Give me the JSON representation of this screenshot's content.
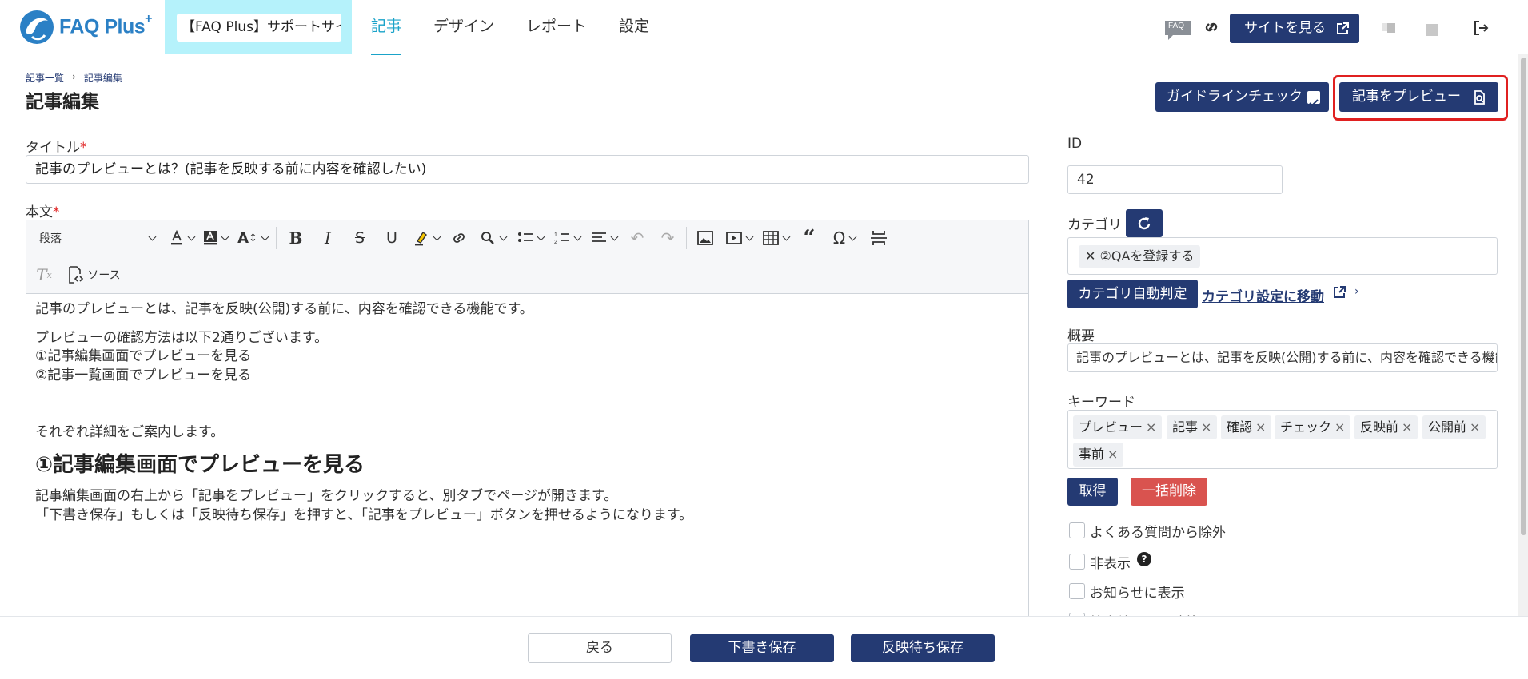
{
  "header": {
    "logo_text": "FAQ Plus",
    "logo_plus": "+",
    "site_selector": "【FAQ Plus】サポートサイト",
    "nav": [
      "記事",
      "デザイン",
      "レポート",
      "設定"
    ],
    "faq_badge": "FAQ",
    "view_site": "サイトを見る"
  },
  "breadcrumb": [
    "記事一覧",
    "記事編集"
  ],
  "page_title": "記事編集",
  "actions": {
    "guideline_check": "ガイドラインチェック",
    "preview": "記事をプレビュー"
  },
  "form": {
    "title_label": "タイトル",
    "required_mark": "*",
    "title_value": "記事のプレビューとは？(記事を反映する前に内容を確認したい)",
    "body_label": "本文"
  },
  "editor": {
    "paragraph_select": "段落",
    "source_label": "ソース",
    "lines": [
      "記事のプレビューとは、記事を反映(公開)する前に、内容を確認できる機能です。",
      "プレビューの確認方法は以下2通りございます。",
      "①記事編集画面でプレビューを見る",
      "②記事一覧画面でプレビューを見る",
      "それぞれ詳細をご案内します。"
    ],
    "heading": "①記事編集画面でプレビューを見る",
    "after_heading": [
      "記事編集画面の右上から「記事をプレビュー」をクリックすると、別タブでページが開きます。",
      "「下書き保存」もしくは「反映待ち保存」を押すと、「記事をプレビュー」ボタンを押せるようになります。"
    ]
  },
  "sidebar": {
    "id_label": "ID",
    "id_value": "42",
    "category_label": "カテゴリ",
    "category_tag": "②QAを登録する",
    "category_auto": "カテゴリ自動判定",
    "category_settings_link": "カテゴリ設定に移動",
    "summary_label": "概要",
    "summary_value": "記事のプレビューとは、記事を反映(公開)する前に、内容を確認できる機能です。",
    "keyword_label": "キーワード",
    "keywords": [
      "プレビュー",
      "記事",
      "確認",
      "チェック",
      "反映前",
      "公開前",
      "事前"
    ],
    "get_button": "取得",
    "clear_button": "一括削除",
    "checkboxes": [
      "よくある質問から除外",
      "非表示",
      "お知らせに表示",
      "検索結果から除外"
    ]
  },
  "footer": {
    "back": "戻る",
    "save_draft": "下書き保存",
    "save_pending": "反映待ち保存"
  },
  "colors": {
    "primary": "#243a73",
    "accent": "#1aa3c9",
    "danger": "#d9534f",
    "highlight_border": "#e02020",
    "site_selector_bg": "#b5f2fb"
  }
}
